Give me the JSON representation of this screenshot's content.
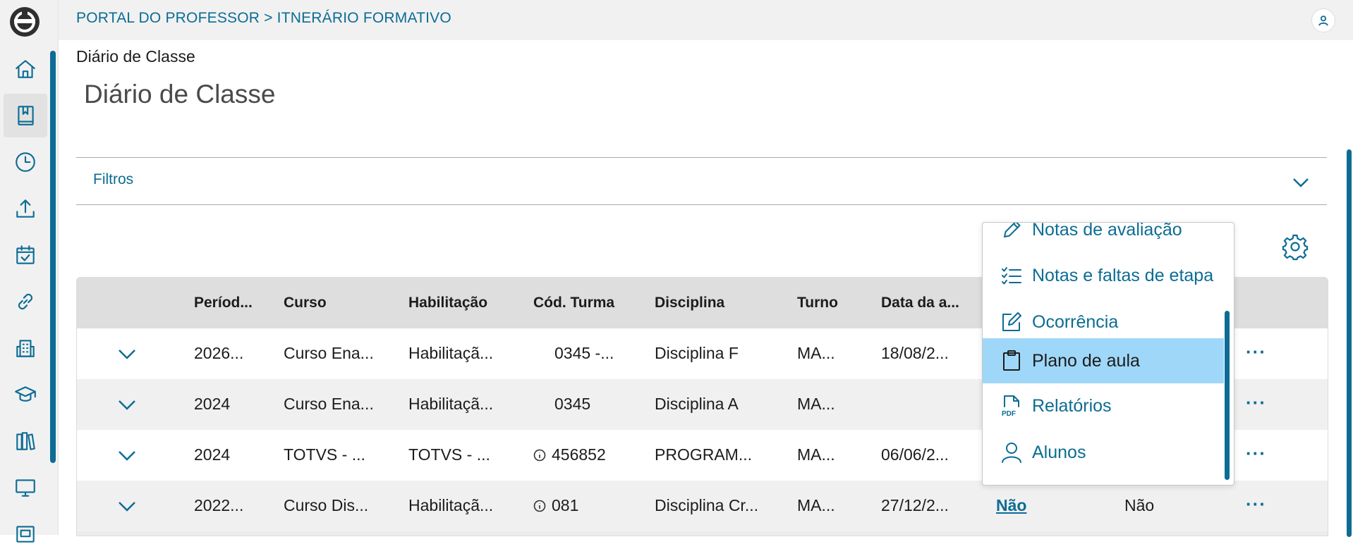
{
  "header": {
    "title": "PORTAL DO PROFESSOR > ITNERÁRIO FORMATIVO"
  },
  "sidebar": {
    "items": [
      {
        "icon": "home-icon"
      },
      {
        "icon": "book-icon",
        "active": true
      },
      {
        "icon": "clock-icon"
      },
      {
        "icon": "upload-icon"
      },
      {
        "icon": "calendar-check-icon"
      },
      {
        "icon": "link-icon"
      },
      {
        "icon": "building-icon"
      },
      {
        "icon": "graduation-cap-icon"
      },
      {
        "icon": "library-icon"
      },
      {
        "icon": "monitor-icon"
      },
      {
        "icon": "id-card-icon"
      }
    ]
  },
  "breadcrumb": "Diário de Classe",
  "page_title": "Diário de Classe",
  "filters": {
    "label": "Filtros"
  },
  "table": {
    "headers": [
      "Períod...",
      "Curso",
      "Habilitação",
      "Cód. Turma",
      "Disciplina",
      "Turno",
      "Data da a..."
    ],
    "rows": [
      {
        "periodo": "2026...",
        "curso": "Curso Ena...",
        "habilitacao": "Habilitaçã...",
        "cod": "0345 -...",
        "info": false,
        "disciplina": "Disciplina F",
        "turno": "MA...",
        "data": "18/08/2...",
        "c8": "",
        "c9": ""
      },
      {
        "periodo": "2024",
        "curso": "Curso Ena...",
        "habilitacao": "Habilitaçã...",
        "cod": "0345",
        "info": false,
        "disciplina": "Disciplina A",
        "turno": "MA...",
        "data": "",
        "c8": "",
        "c9": ""
      },
      {
        "periodo": "2024",
        "curso": "TOTVS - ...",
        "habilitacao": "TOTVS - ...",
        "cod": "456852",
        "info": true,
        "disciplina": "PROGRAM...",
        "turno": "MA...",
        "data": "06/06/2...",
        "c8": "",
        "c9": ""
      },
      {
        "periodo": "2022...",
        "curso": "Curso Dis...",
        "habilitacao": "Habilitaçã...",
        "cod": "081",
        "info": true,
        "disciplina": "Disciplina Cr...",
        "turno": "MA...",
        "data": "27/12/2...",
        "c8": "Não",
        "c9": "Não"
      }
    ],
    "more_label": "···"
  },
  "context_menu": {
    "items": [
      {
        "label": "Notas de avaliação",
        "icon": "pencil-icon"
      },
      {
        "label": "Notas e faltas de etapa",
        "icon": "checklist-icon"
      },
      {
        "label": "Ocorrência",
        "icon": "edit-icon"
      },
      {
        "label": "Plano de aula",
        "icon": "clipboard-icon",
        "selected": true
      },
      {
        "label": "Relatórios",
        "icon": "pdf-icon"
      },
      {
        "label": "Alunos",
        "icon": "user-icon"
      }
    ]
  },
  "colors": {
    "accent": "#0c6c94",
    "selected": "#9fd7f8"
  }
}
